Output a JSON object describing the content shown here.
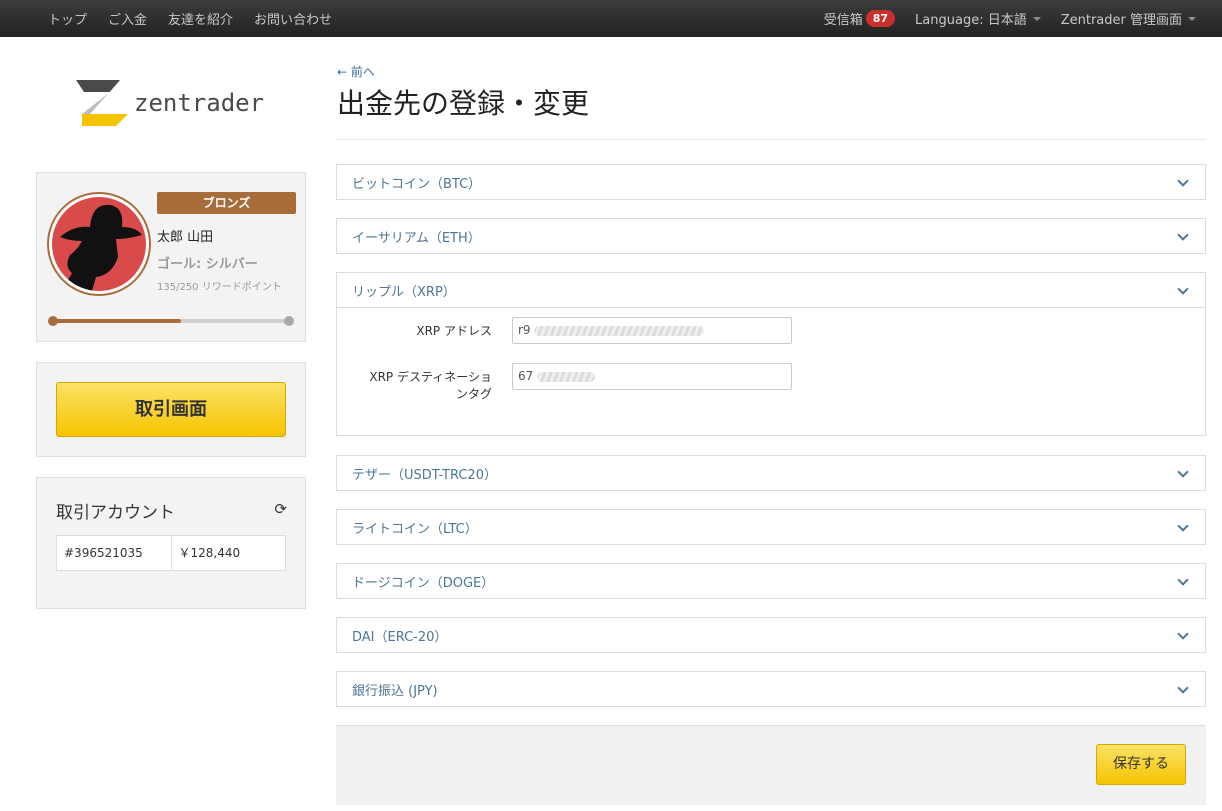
{
  "nav": {
    "left": [
      "トップ",
      "ご入金",
      "友達を紹介",
      "お問い合わせ"
    ],
    "inbox_label": "受信箱",
    "inbox_count": "87",
    "language": "Language: 日本語",
    "admin": "Zentrader 管理画面"
  },
  "logo": {
    "text": "zentrader"
  },
  "profile": {
    "rank": "ブロンズ",
    "name": "太郎 山田",
    "goal": "ゴール: シルバー",
    "points": "135/250 リワードポイント",
    "progress_fraction": 0.54
  },
  "trade_button": "取引画面",
  "account": {
    "title": "取引アカウント",
    "number": "#396521035",
    "balance": "￥128,440"
  },
  "page": {
    "back": "← 前へ",
    "title": "出金先の登録・変更"
  },
  "accordions": [
    {
      "label": "ビットコイン（BTC）"
    },
    {
      "label": "イーサリアム（ETH）"
    },
    {
      "label": "リップル（XRP）"
    },
    {
      "label": "テザー（USDT-TRC20）"
    },
    {
      "label": "ライトコイン（LTC）"
    },
    {
      "label": "ドージコイン（DOGE）"
    },
    {
      "label": "DAI（ERC-20）"
    },
    {
      "label": "銀行振込 (JPY)"
    }
  ],
  "xrp_form": {
    "address_label": "XRP アドレス",
    "address_value": "r9",
    "tag_label_1": "XRP デスティネーショ",
    "tag_label_2": "ンタグ",
    "tag_value": "67"
  },
  "save_button": "保存する",
  "colors": {
    "accent_yellow": "#f5c400",
    "bronze": "#a86b3a",
    "link_blue": "#4c7696",
    "badge_red": "#c9302c"
  }
}
